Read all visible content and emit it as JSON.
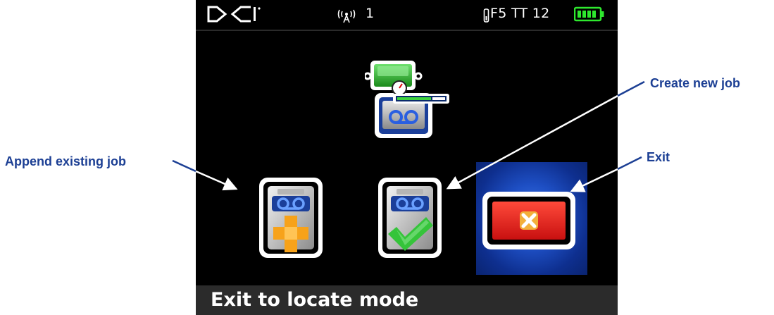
{
  "status_bar": {
    "brand": "DCI",
    "channel": "1",
    "transmitter_info": "F5 TT 12",
    "icons": [
      "dci-logo-icon",
      "signal-icon",
      "transmitter-icon",
      "battery-icon"
    ],
    "battery_level": 1.0
  },
  "menu": {
    "header_icon": "job-recording-icon",
    "options": [
      {
        "id": "append",
        "icon": "tape-plus-icon",
        "selected": false
      },
      {
        "id": "create",
        "icon": "tape-check-icon",
        "selected": false
      },
      {
        "id": "exit",
        "icon": "exit-x-icon",
        "selected": true
      }
    ]
  },
  "help_bar": {
    "text": "Exit to locate mode"
  },
  "callouts": {
    "append_label": "Append existing job",
    "create_label": "Create new job",
    "exit_label": "Exit"
  },
  "colors": {
    "screen_bg": "#000000",
    "help_bar_bg": "#2b2b2b",
    "highlight": "#2a5fd6",
    "callout_text": "#1c3f94",
    "battery_green": "#2ee82e",
    "exit_red": "#e31b1b",
    "plus_orange": "#f7a21a",
    "check_green": "#35c43a",
    "tape_blue": "#2a5fe0"
  }
}
